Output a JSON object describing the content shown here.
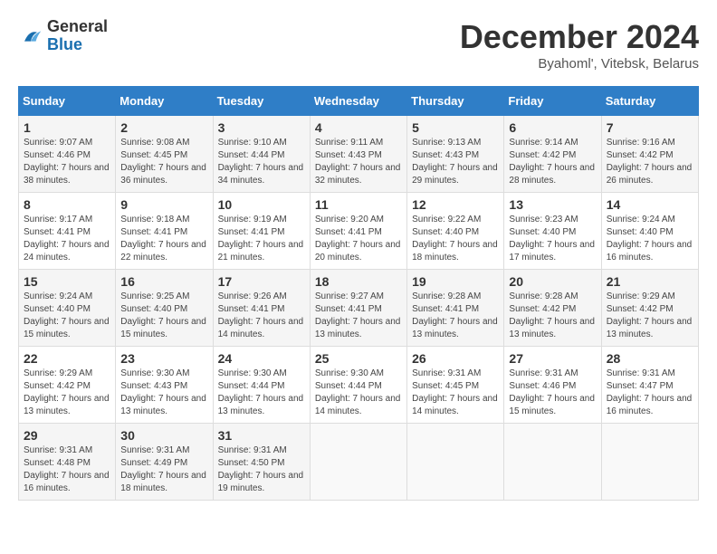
{
  "header": {
    "logo_general": "General",
    "logo_blue": "Blue",
    "title": "December 2024",
    "subtitle": "Byahoml', Vitebsk, Belarus"
  },
  "days_of_week": [
    "Sunday",
    "Monday",
    "Tuesday",
    "Wednesday",
    "Thursday",
    "Friday",
    "Saturday"
  ],
  "weeks": [
    [
      {
        "day": 1,
        "sunrise": "Sunrise: 9:07 AM",
        "sunset": "Sunset: 4:46 PM",
        "daylight": "Daylight: 7 hours and 38 minutes."
      },
      {
        "day": 2,
        "sunrise": "Sunrise: 9:08 AM",
        "sunset": "Sunset: 4:45 PM",
        "daylight": "Daylight: 7 hours and 36 minutes."
      },
      {
        "day": 3,
        "sunrise": "Sunrise: 9:10 AM",
        "sunset": "Sunset: 4:44 PM",
        "daylight": "Daylight: 7 hours and 34 minutes."
      },
      {
        "day": 4,
        "sunrise": "Sunrise: 9:11 AM",
        "sunset": "Sunset: 4:43 PM",
        "daylight": "Daylight: 7 hours and 32 minutes."
      },
      {
        "day": 5,
        "sunrise": "Sunrise: 9:13 AM",
        "sunset": "Sunset: 4:43 PM",
        "daylight": "Daylight: 7 hours and 29 minutes."
      },
      {
        "day": 6,
        "sunrise": "Sunrise: 9:14 AM",
        "sunset": "Sunset: 4:42 PM",
        "daylight": "Daylight: 7 hours and 28 minutes."
      },
      {
        "day": 7,
        "sunrise": "Sunrise: 9:16 AM",
        "sunset": "Sunset: 4:42 PM",
        "daylight": "Daylight: 7 hours and 26 minutes."
      }
    ],
    [
      {
        "day": 8,
        "sunrise": "Sunrise: 9:17 AM",
        "sunset": "Sunset: 4:41 PM",
        "daylight": "Daylight: 7 hours and 24 minutes."
      },
      {
        "day": 9,
        "sunrise": "Sunrise: 9:18 AM",
        "sunset": "Sunset: 4:41 PM",
        "daylight": "Daylight: 7 hours and 22 minutes."
      },
      {
        "day": 10,
        "sunrise": "Sunrise: 9:19 AM",
        "sunset": "Sunset: 4:41 PM",
        "daylight": "Daylight: 7 hours and 21 minutes."
      },
      {
        "day": 11,
        "sunrise": "Sunrise: 9:20 AM",
        "sunset": "Sunset: 4:41 PM",
        "daylight": "Daylight: 7 hours and 20 minutes."
      },
      {
        "day": 12,
        "sunrise": "Sunrise: 9:22 AM",
        "sunset": "Sunset: 4:40 PM",
        "daylight": "Daylight: 7 hours and 18 minutes."
      },
      {
        "day": 13,
        "sunrise": "Sunrise: 9:23 AM",
        "sunset": "Sunset: 4:40 PM",
        "daylight": "Daylight: 7 hours and 17 minutes."
      },
      {
        "day": 14,
        "sunrise": "Sunrise: 9:24 AM",
        "sunset": "Sunset: 4:40 PM",
        "daylight": "Daylight: 7 hours and 16 minutes."
      }
    ],
    [
      {
        "day": 15,
        "sunrise": "Sunrise: 9:24 AM",
        "sunset": "Sunset: 4:40 PM",
        "daylight": "Daylight: 7 hours and 15 minutes."
      },
      {
        "day": 16,
        "sunrise": "Sunrise: 9:25 AM",
        "sunset": "Sunset: 4:40 PM",
        "daylight": "Daylight: 7 hours and 15 minutes."
      },
      {
        "day": 17,
        "sunrise": "Sunrise: 9:26 AM",
        "sunset": "Sunset: 4:41 PM",
        "daylight": "Daylight: 7 hours and 14 minutes."
      },
      {
        "day": 18,
        "sunrise": "Sunrise: 9:27 AM",
        "sunset": "Sunset: 4:41 PM",
        "daylight": "Daylight: 7 hours and 13 minutes."
      },
      {
        "day": 19,
        "sunrise": "Sunrise: 9:28 AM",
        "sunset": "Sunset: 4:41 PM",
        "daylight": "Daylight: 7 hours and 13 minutes."
      },
      {
        "day": 20,
        "sunrise": "Sunrise: 9:28 AM",
        "sunset": "Sunset: 4:42 PM",
        "daylight": "Daylight: 7 hours and 13 minutes."
      },
      {
        "day": 21,
        "sunrise": "Sunrise: 9:29 AM",
        "sunset": "Sunset: 4:42 PM",
        "daylight": "Daylight: 7 hours and 13 minutes."
      }
    ],
    [
      {
        "day": 22,
        "sunrise": "Sunrise: 9:29 AM",
        "sunset": "Sunset: 4:42 PM",
        "daylight": "Daylight: 7 hours and 13 minutes."
      },
      {
        "day": 23,
        "sunrise": "Sunrise: 9:30 AM",
        "sunset": "Sunset: 4:43 PM",
        "daylight": "Daylight: 7 hours and 13 minutes."
      },
      {
        "day": 24,
        "sunrise": "Sunrise: 9:30 AM",
        "sunset": "Sunset: 4:44 PM",
        "daylight": "Daylight: 7 hours and 13 minutes."
      },
      {
        "day": 25,
        "sunrise": "Sunrise: 9:30 AM",
        "sunset": "Sunset: 4:44 PM",
        "daylight": "Daylight: 7 hours and 14 minutes."
      },
      {
        "day": 26,
        "sunrise": "Sunrise: 9:31 AM",
        "sunset": "Sunset: 4:45 PM",
        "daylight": "Daylight: 7 hours and 14 minutes."
      },
      {
        "day": 27,
        "sunrise": "Sunrise: 9:31 AM",
        "sunset": "Sunset: 4:46 PM",
        "daylight": "Daylight: 7 hours and 15 minutes."
      },
      {
        "day": 28,
        "sunrise": "Sunrise: 9:31 AM",
        "sunset": "Sunset: 4:47 PM",
        "daylight": "Daylight: 7 hours and 16 minutes."
      }
    ],
    [
      {
        "day": 29,
        "sunrise": "Sunrise: 9:31 AM",
        "sunset": "Sunset: 4:48 PM",
        "daylight": "Daylight: 7 hours and 16 minutes."
      },
      {
        "day": 30,
        "sunrise": "Sunrise: 9:31 AM",
        "sunset": "Sunset: 4:49 PM",
        "daylight": "Daylight: 7 hours and 18 minutes."
      },
      {
        "day": 31,
        "sunrise": "Sunrise: 9:31 AM",
        "sunset": "Sunset: 4:50 PM",
        "daylight": "Daylight: 7 hours and 19 minutes."
      },
      null,
      null,
      null,
      null
    ]
  ]
}
